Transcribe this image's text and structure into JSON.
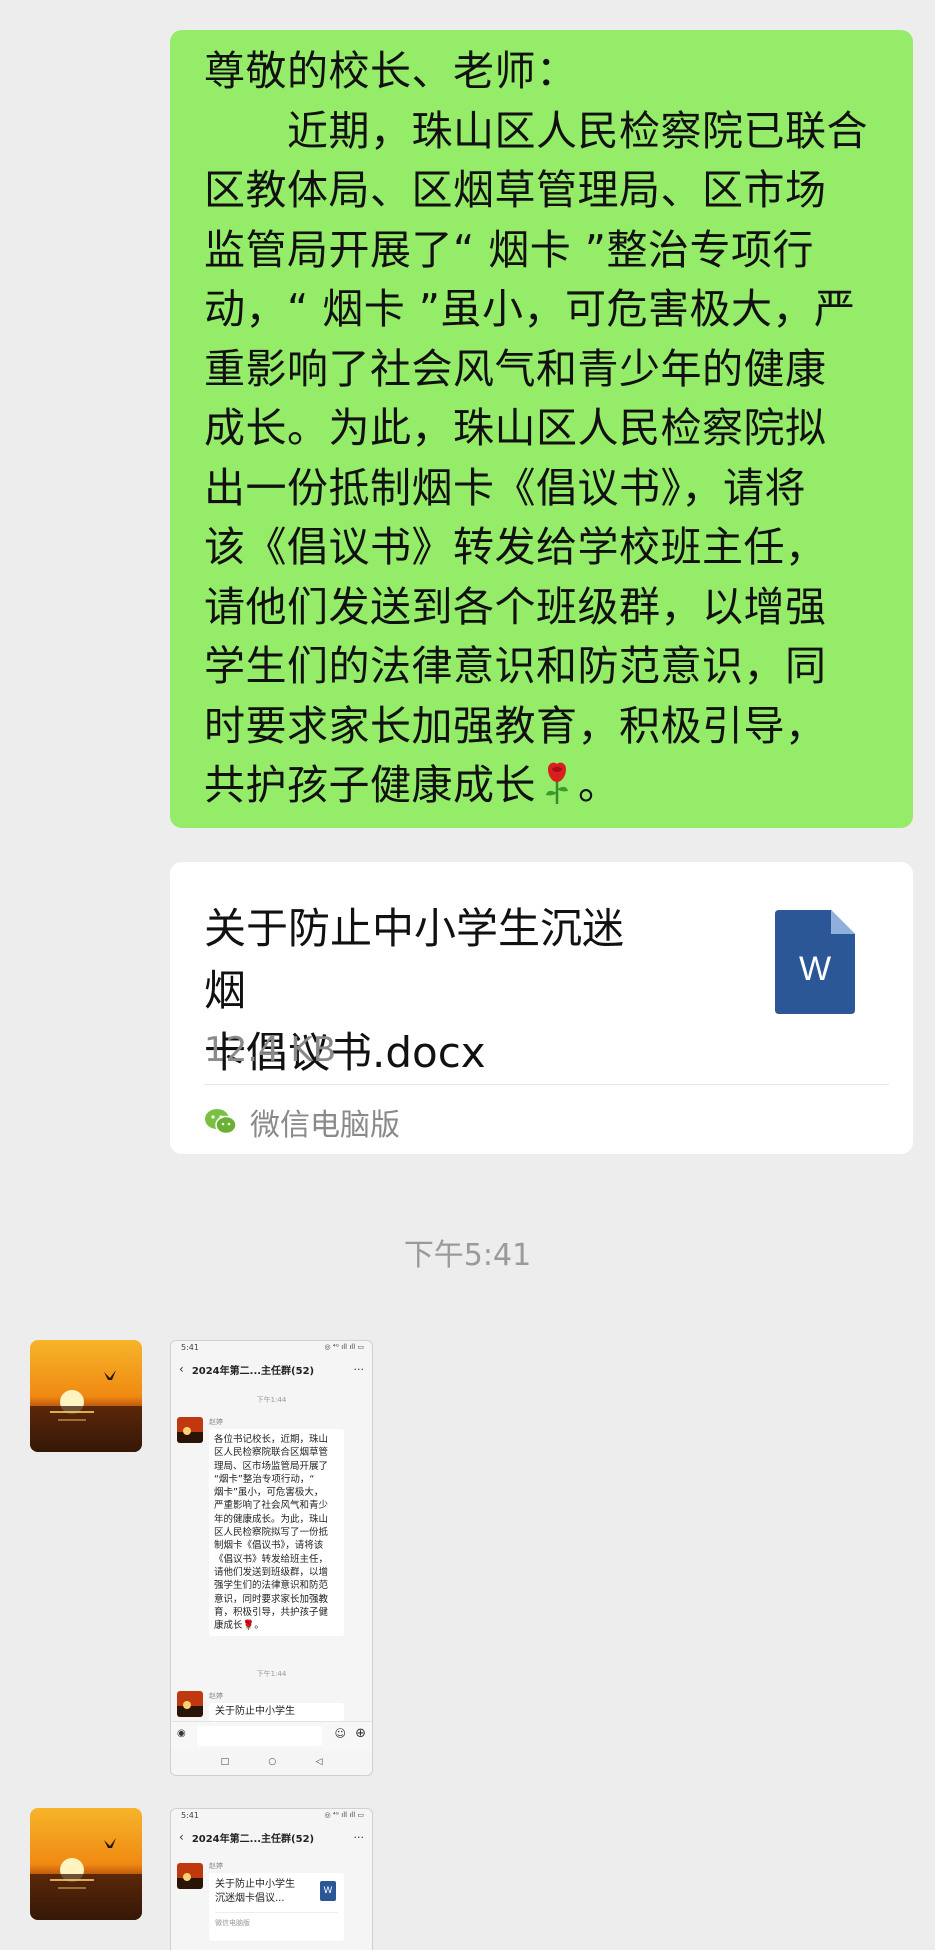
{
  "announcement_bubble": {
    "lines": [
      "尊敬的校长、老师：",
      "　　近期，珠山区人民检察院已联合",
      "区教体局、区烟草管理局、区市场",
      "监管局开展了“ 烟卡 ”整治专项行",
      "动，“ 烟卡 ”虽小，可危害极大，严",
      "重影响了社会风气和青少年的健康",
      "成长。为此，珠山区人民检察院拟",
      "出一份抵制烟卡《倡议书》，请将",
      "该《倡议书》转发给学校班主任，",
      "请他们发送到各个班级群，以增强",
      "学生们的法律意识和防范意识，同",
      "时要求家长加强教育，积极引导，"
    ],
    "last_line_before_emoji": "共护孩子健康成长",
    "emoji": "rose-icon",
    "last_line_after_emoji": "。"
  },
  "file_card": {
    "name_line1": "关于防止中小学生沉迷烟",
    "name_line2": "卡倡议书.docx",
    "size": "12.4 KB",
    "icon_letter": "W",
    "source": "微信电脑版"
  },
  "timestamp": "下午5:41",
  "screenshot1": {
    "status_time": "5:41",
    "status_right": "◎ ⁴ᴳ ıll ıll ▭",
    "back": "‹",
    "title": "2024年第二...主任群(52)",
    "more": "···",
    "time1": "下午1:44",
    "sender": "赵婷",
    "message_lines": [
      "各位书记校长，近期，珠山",
      "区人民检察院联合区烟草管",
      "理局、区市场监管局开展了",
      "“烟卡”整治专项行动，“",
      "烟卡”虽小，可危害极大，",
      "严重影响了社会风气和青少",
      "年的健康成长。为此，珠山",
      "区人民检察院拟写了一份抵",
      "制烟卡《倡议书》，请将该",
      "《倡议书》转发给班主任，",
      "请他们发送到班级群，以增",
      "强学生们的法律意识和防范",
      "意识，同时要求家长加强教",
      "育，积极引导，共护孩子健",
      "康成长🌹。"
    ],
    "time2": "下午1:44",
    "sender2": "赵婷",
    "file_preview": "关于防止中小学生",
    "nav": [
      "□",
      "○",
      "◁"
    ]
  },
  "screenshot2": {
    "status_time": "5:41",
    "status_right": "◎ ⁴ᴳ ıll ıll ▭",
    "back": "‹",
    "title": "2024年第二...主任群(52)",
    "more": "···",
    "sender": "赵婷",
    "file_line1": "关于防止中小学生",
    "file_line2": "沉迷烟卡倡议...",
    "file_icon": "W",
    "file_source": "微信电脑版"
  },
  "colors": {
    "bubble_green": "#95ec69",
    "background": "#ededed",
    "word_blue": "#2b5797"
  }
}
